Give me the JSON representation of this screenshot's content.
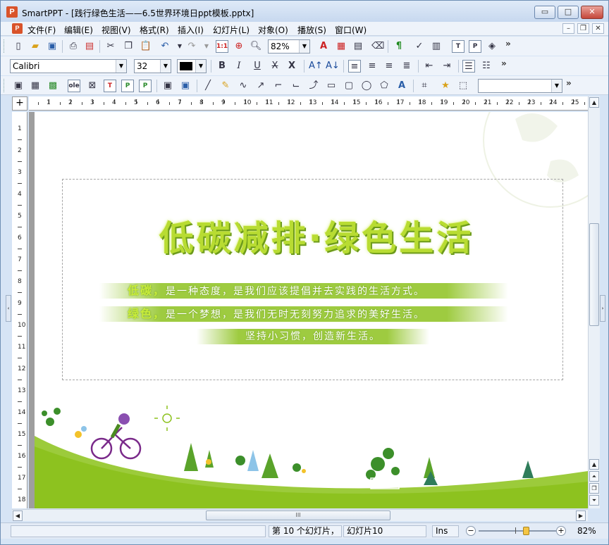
{
  "window": {
    "app_icon": "P",
    "title": "SmartPPT - [践行绿色生活——6.5世界环境日ppt模板.pptx]",
    "buttons": {
      "minimize": "▭",
      "maximize": "□",
      "close": "✕"
    }
  },
  "menubar": {
    "doc_icon": "P",
    "items": [
      {
        "label": "文件(F)"
      },
      {
        "label": "编辑(E)"
      },
      {
        "label": "视图(V)"
      },
      {
        "label": "格式(R)"
      },
      {
        "label": "插入(I)"
      },
      {
        "label": "幻灯片(L)"
      },
      {
        "label": "对象(O)"
      },
      {
        "label": "播放(S)"
      },
      {
        "label": "窗口(W)"
      }
    ],
    "mdi": {
      "minimize": "–",
      "restore": "❐",
      "close": "✕"
    }
  },
  "toolbar1": {
    "zoom_value": "82%",
    "actual_size_label": "1:1",
    "more": "»"
  },
  "toolbar2": {
    "font_name": "Calibri",
    "font_size": "32",
    "bold": "B",
    "italic": "I",
    "underline": "U",
    "strike": "X",
    "clear": "X",
    "more": "»"
  },
  "toolbar3": {
    "object_label": "ole",
    "shape_select_value": "",
    "more": "»"
  },
  "ruler": {
    "h_labels": [
      "1",
      "2",
      "3",
      "4",
      "5",
      "6",
      "7",
      "8",
      "9",
      "10",
      "11",
      "12",
      "13",
      "14",
      "15",
      "16",
      "17",
      "18",
      "19",
      "20",
      "21",
      "22",
      "23",
      "24",
      "25"
    ],
    "v_labels": [
      "1",
      "2",
      "3",
      "4",
      "5",
      "6",
      "7",
      "8",
      "9",
      "10",
      "11",
      "12",
      "13",
      "14",
      "15",
      "16",
      "17",
      "18"
    ],
    "corner": "+"
  },
  "slide": {
    "headline": "低碳减排·绿色生活",
    "line1_key": "低碳，",
    "line1_rest": "是一种态度，是我们应该提倡并去实践的生活方式。",
    "line2_key": "绿色，",
    "line2_rest": "是一个梦想，是我们无时无刻努力追求的美好生活。",
    "line3": "坚持小习惯，创造新生活。"
  },
  "hscroll": {
    "grip": "III"
  },
  "statusbar": {
    "slide_position": "第 10 个幻灯片，",
    "slide_name": "幻灯片10",
    "mode": "Ins",
    "zoom": "82%",
    "zoom_minus": "−",
    "zoom_plus": "+",
    "zoom_level": 0.62
  },
  "colors": {
    "accent_green": "#8dc21f",
    "hill_green": "#9ccb3b",
    "headline": "#b8dc32"
  }
}
